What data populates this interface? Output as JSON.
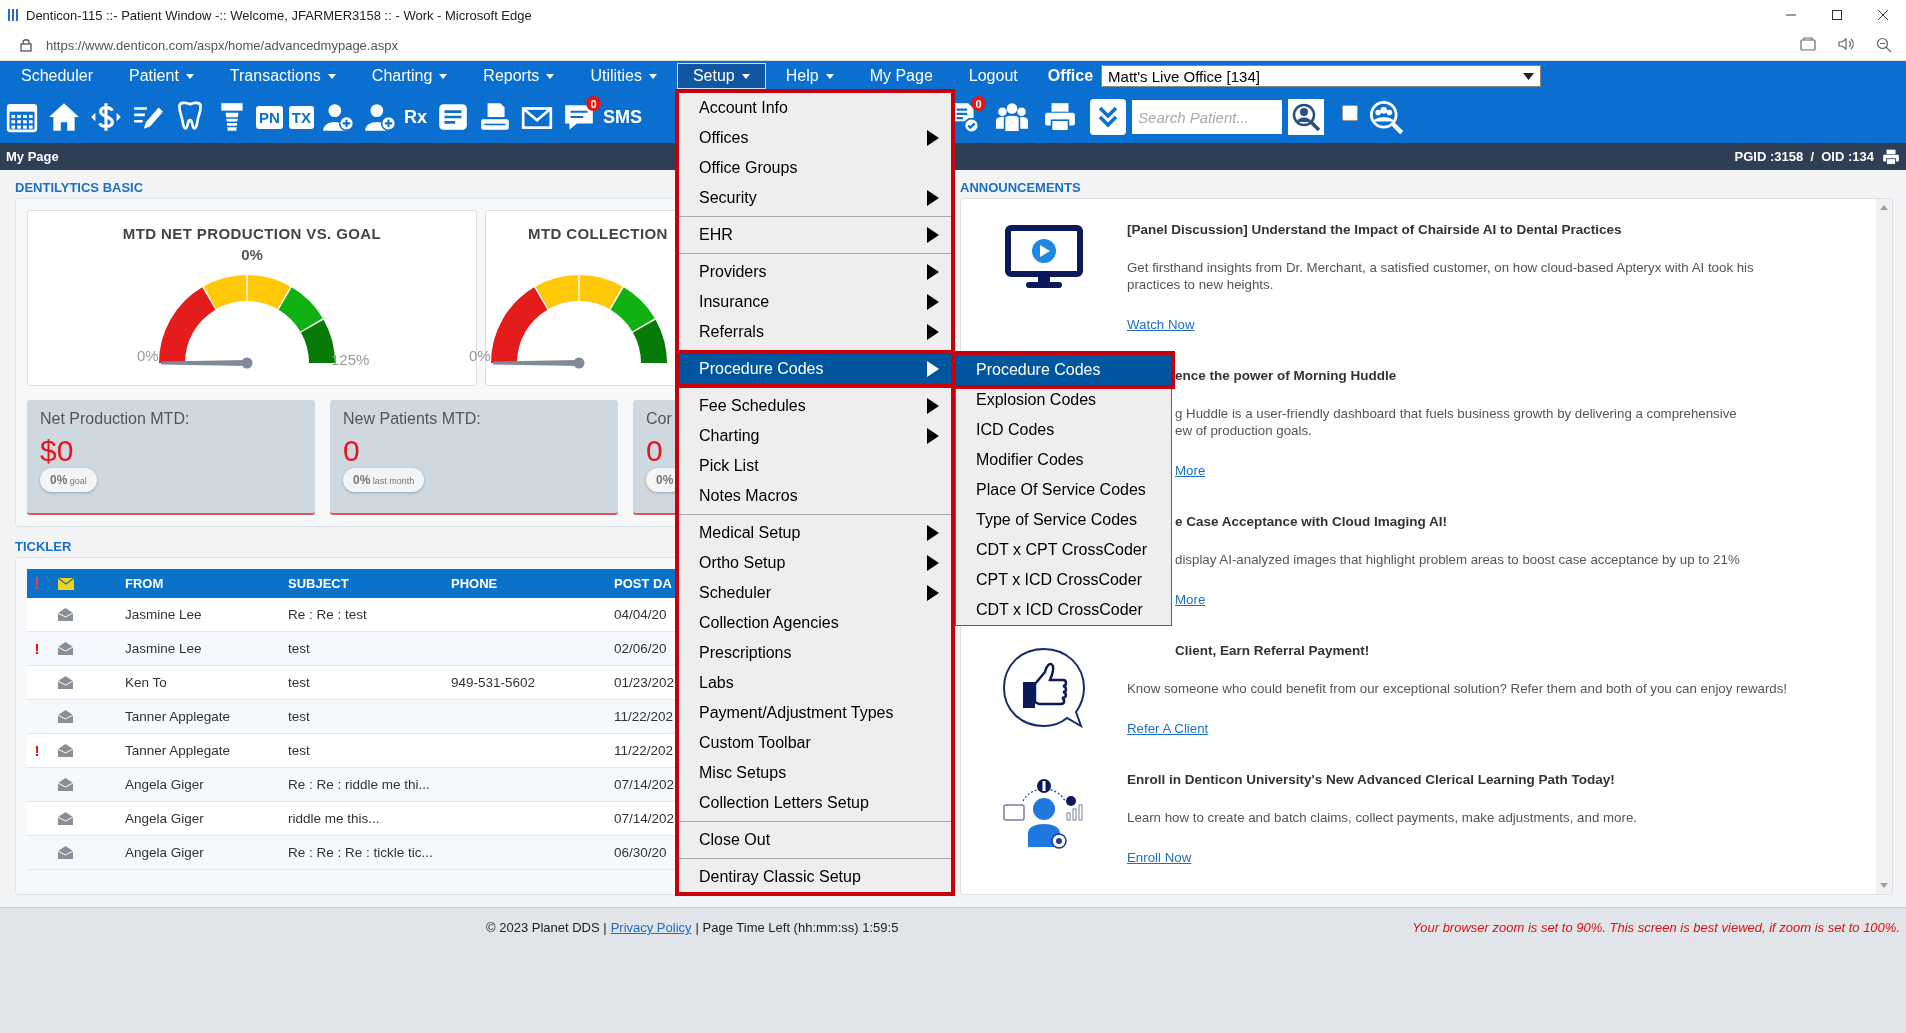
{
  "window": {
    "title": "Denticon-115 ::- Patient Window -:: Welcome, JFARMER3158 :: - Work - Microsoft Edge"
  },
  "address_bar": {
    "url": "https://www.denticon.com/aspx/home/advancedmypage.aspx"
  },
  "nav": {
    "items": [
      {
        "label": "Scheduler",
        "dropdown": false,
        "selected": false
      },
      {
        "label": "Patient",
        "dropdown": true,
        "selected": false
      },
      {
        "label": "Transactions",
        "dropdown": true,
        "selected": false
      },
      {
        "label": "Charting",
        "dropdown": true,
        "selected": false
      },
      {
        "label": "Reports",
        "dropdown": true,
        "selected": false
      },
      {
        "label": "Utilities",
        "dropdown": true,
        "selected": false
      },
      {
        "label": "Setup",
        "dropdown": true,
        "selected": true
      },
      {
        "label": "Help",
        "dropdown": true,
        "selected": false
      },
      {
        "label": "My Page",
        "dropdown": false,
        "selected": false
      },
      {
        "label": "Logout",
        "dropdown": false,
        "selected": false
      }
    ],
    "office_label": "Office",
    "office_select": "Matt's Live Office [134]"
  },
  "toolbar": {
    "left": [
      {
        "kind": "calendar"
      },
      {
        "kind": "home"
      },
      {
        "kind": "dollar"
      },
      {
        "kind": "edit"
      },
      {
        "kind": "tooth"
      },
      {
        "kind": "implant"
      },
      {
        "kind": "tile",
        "label": "PN"
      },
      {
        "kind": "tile",
        "label": "TX"
      },
      {
        "kind": "person-add"
      },
      {
        "kind": "person-add"
      },
      {
        "kind": "letters",
        "label": "Rx"
      },
      {
        "kind": "note"
      },
      {
        "kind": "scan"
      },
      {
        "kind": "mail"
      },
      {
        "kind": "chat",
        "badge": "0"
      },
      {
        "kind": "letters",
        "label": "SMS"
      }
    ],
    "right": [
      {
        "kind": "doc-check",
        "badge": "0"
      },
      {
        "kind": "people"
      },
      {
        "kind": "printer"
      },
      {
        "kind": "chevron-tile"
      },
      {
        "kind": "search-field",
        "placeholder": "Search Patient..."
      },
      {
        "kind": "person-search"
      },
      {
        "kind": "checkbox",
        "checked": false
      },
      {
        "kind": "group-search"
      }
    ]
  },
  "page_bar": {
    "title": "My Page",
    "ids": "PGID :3158  /  OID :134"
  },
  "dentilytics": {
    "heading": "DENTILYTICS BASIC",
    "gauges": [
      {
        "kind": "full",
        "title": "MTD NET PRODUCTION VS. GOAL",
        "value": "0%",
        "min": "0%",
        "max": "125%"
      },
      {
        "kind": "clipped",
        "title": "MTD COLLECTION",
        "min": "0%"
      }
    ],
    "stats": [
      {
        "title": "Net Production MTD:",
        "value": "$0",
        "badge": "0%",
        "badge_note": "goal"
      },
      {
        "title": "New Patients MTD:",
        "value": "0",
        "badge": "0%",
        "badge_note": "last month"
      },
      {
        "title": "Cor",
        "value": "0",
        "badge": "0%"
      }
    ]
  },
  "tickler": {
    "heading": "TICKLER",
    "flag_header": "!",
    "columns": [
      "FROM",
      "SUBJECT",
      "PHONE",
      "POST DA"
    ],
    "rows": [
      {
        "from": "Jasmine Lee",
        "subject": "Re : Re : test",
        "date": "04/04/20"
      },
      {
        "flag": "!",
        "from": "Jasmine Lee",
        "subject": "test",
        "date": "02/06/20"
      },
      {
        "from": "Ken To",
        "subject": "test",
        "phone": "949-531-5602",
        "date": "01/23/202"
      },
      {
        "from": "Tanner Applegate",
        "subject": "test",
        "date": "11/22/202"
      },
      {
        "flag": "!",
        "from": "Tanner Applegate",
        "subject": "test",
        "date": "11/22/202"
      },
      {
        "from": "Angela Giger",
        "subject": "Re : Re : riddle me thi...",
        "date": "07/14/202"
      },
      {
        "from": "Angela Giger",
        "subject": "riddle me this...",
        "date": "07/14/202"
      },
      {
        "from": "Angela Giger",
        "subject": "Re : Re : Re : tickle tic...",
        "date": "06/30/20"
      }
    ]
  },
  "announcements": {
    "heading": "ANNOUNCEMENTS",
    "items": [
      {
        "kind": "open",
        "title": "[Panel Discussion] Understand the Impact of Chairside AI to Dental Practices",
        "body": "Get firsthand insights from Dr. Merchant, a satisfied customer, on how cloud-based Apteryx with AI took his practices to new heights.",
        "link": "Watch Now"
      },
      {
        "kind": "covered",
        "title": "ence the power of Morning Huddle",
        "body_lines": [
          "g Huddle is a user-friendly dashboard that fuels business growth by delivering a comprehensive",
          "ew of production goals."
        ],
        "link": "More"
      },
      {
        "kind": "covered",
        "title": "e Case Acceptance with Cloud Imaging AI!",
        "body_lines": [
          "display AI-analyzed images that highlight problem areas to boost case acceptance by up to 21%"
        ],
        "link": "More"
      },
      {
        "kind": "title-covered",
        "title": "Client, Earn Referral Payment!",
        "body": "Know someone who could benefit from our exceptional solution? Refer them and both of you can enjoy rewards!",
        "link": "Refer A Client"
      },
      {
        "kind": "open",
        "title": "Enroll in Denticon University's New Advanced Clerical Learning Path Today!",
        "body": "Learn how to create and batch claims, collect payments, make adjustments, and more.",
        "link": "Enroll Now"
      }
    ]
  },
  "footer": {
    "copyright": "© 2023 Planet DDS |",
    "privacy_link": "Privacy Policy",
    "timer": "| Page Time Left (hh:mm:ss) 1:59:5",
    "zoom_warning": "Your browser zoom is set to 90%. This screen is best viewed, if zoom is set to 100%."
  },
  "setup_menu": {
    "groups": [
      [
        {
          "label": "Account Info",
          "submenu": false,
          "selected": false
        },
        {
          "label": "Offices",
          "submenu": true,
          "selected": false
        },
        {
          "label": "Office Groups",
          "submenu": false,
          "selected": false
        },
        {
          "label": "Security",
          "submenu": true,
          "selected": false
        }
      ],
      [
        {
          "label": "EHR",
          "submenu": true,
          "selected": false
        }
      ],
      [
        {
          "label": "Providers",
          "submenu": true,
          "selected": false
        },
        {
          "label": "Insurance",
          "submenu": true,
          "selected": false
        },
        {
          "label": "Referrals",
          "submenu": true,
          "selected": false
        }
      ],
      [
        {
          "label": "Procedure Codes",
          "submenu": true,
          "selected": true
        }
      ],
      [
        {
          "label": "Fee Schedules",
          "submenu": true,
          "selected": false
        },
        {
          "label": "Charting",
          "submenu": true,
          "selected": false
        },
        {
          "label": "Pick List",
          "submenu": false,
          "selected": false
        },
        {
          "label": "Notes Macros",
          "submenu": false,
          "selected": false
        }
      ],
      [
        {
          "label": "Medical Setup",
          "submenu": true,
          "selected": false
        },
        {
          "label": "Ortho Setup",
          "submenu": true,
          "selected": false
        },
        {
          "label": "Scheduler",
          "submenu": true,
          "selected": false
        },
        {
          "label": "Collection Agencies",
          "submenu": false,
          "selected": false
        },
        {
          "label": "Prescriptions",
          "submenu": false,
          "selected": false
        },
        {
          "label": "Labs",
          "submenu": false,
          "selected": false
        },
        {
          "label": "Payment/Adjustment Types",
          "submenu": false,
          "selected": false
        },
        {
          "label": "Custom Toolbar",
          "submenu": false,
          "selected": false
        },
        {
          "label": "Misc Setups",
          "submenu": false,
          "selected": false
        },
        {
          "label": "Collection Letters Setup",
          "submenu": false,
          "selected": false
        }
      ],
      [
        {
          "label": "Close Out",
          "submenu": false,
          "selected": false
        }
      ],
      [
        {
          "label": "Dentiray Classic Setup",
          "submenu": false,
          "selected": false
        }
      ]
    ],
    "submenu": [
      {
        "label": "Procedure Codes",
        "selected": true
      },
      {
        "label": "Explosion Codes",
        "selected": false
      },
      {
        "label": "ICD Codes",
        "selected": false
      },
      {
        "label": "Modifier Codes",
        "selected": false
      },
      {
        "label": "Place Of Service Codes",
        "selected": false
      },
      {
        "label": "Type of Service Codes",
        "selected": false
      },
      {
        "label": "CDT x CPT CrossCoder",
        "selected": false
      },
      {
        "label": "CPT x ICD CrossCoder",
        "selected": false
      },
      {
        "label": "CDT x ICD CrossCoder",
        "selected": false
      }
    ]
  }
}
